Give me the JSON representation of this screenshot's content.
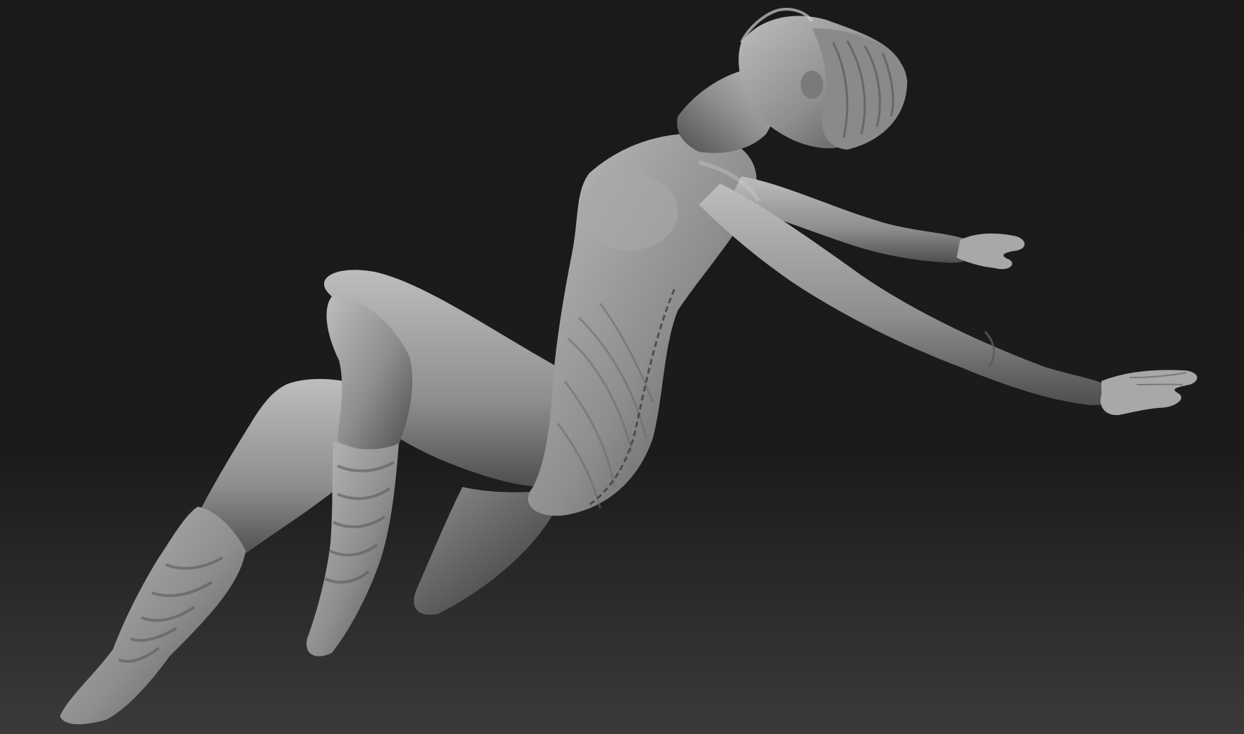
{
  "scene": {
    "subject": "sculpt-figure",
    "colors": {
      "background_top": "#1a1a1a",
      "background_mid": "#1b1b1b",
      "background_bottom": "#3a3a3a",
      "clay_light": "#bdbdbd",
      "clay_mid": "#8e8e8e",
      "clay_dark": "#4e4e4e",
      "clay_shadow": "#2e2e2e"
    }
  }
}
